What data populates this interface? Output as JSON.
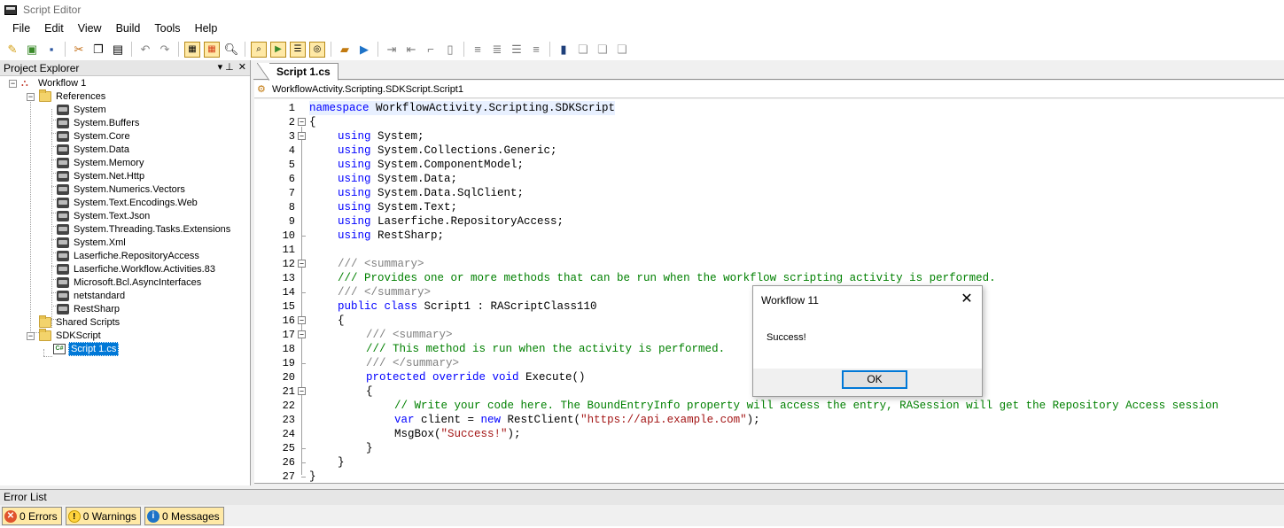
{
  "window": {
    "title": "Script Editor"
  },
  "menu": [
    "File",
    "Edit",
    "View",
    "Build",
    "Tools",
    "Help"
  ],
  "toolbar_icons": [
    "new-icon",
    "open-icon",
    "save-icon",
    "cut-icon",
    "copy-icon",
    "paste-icon",
    "undo-icon",
    "redo-icon",
    "toggle-view-icon",
    "highlight-icon",
    "find-icon",
    "find-replace-icon",
    "run-window-icon",
    "script-window-icon",
    "debug-window-icon",
    "build-icon",
    "run-icon",
    "indent-icon",
    "outdent-icon",
    "comment-icon",
    "uncomment-icon",
    "align-left-icon",
    "align-center-icon",
    "align-right-icon",
    "justify-icon",
    "window-icon",
    "cascade-icon",
    "tile-icon",
    "close-all-icon"
  ],
  "project_explorer": {
    "title": "Project Explorer",
    "pin_label": "▾ ⊥",
    "close_label": "✕",
    "root": "Workflow 1",
    "references_label": "References",
    "references": [
      "System",
      "System.Buffers",
      "System.Core",
      "System.Data",
      "System.Memory",
      "System.Net.Http",
      "System.Numerics.Vectors",
      "System.Text.Encodings.Web",
      "System.Text.Json",
      "System.Threading.Tasks.Extensions",
      "System.Xml",
      "Laserfiche.RepositoryAccess",
      "Laserfiche.Workflow.Activities.83",
      "Microsoft.Bcl.AsyncInterfaces",
      "netstandard",
      "RestSharp"
    ],
    "shared_scripts": "Shared Scripts",
    "sdk_script": "SDKScript",
    "selected_file": "Script 1.cs"
  },
  "editor": {
    "tab": "Script 1.cs",
    "class_path": "WorkflowActivity.Scripting.SDKScript.Script1",
    "line_numbers": [
      "1",
      "2",
      "3",
      "4",
      "5",
      "6",
      "7",
      "8",
      "9",
      "10",
      "11",
      "12",
      "13",
      "14",
      "15",
      "16",
      "17",
      "18",
      "19",
      "20",
      "21",
      "22",
      "23",
      "24",
      "25",
      "26",
      "27"
    ],
    "code": {
      "l1_kw": "namespace",
      "l1_rest": " WorkflowActivity.Scripting.SDKScript",
      "l2": "{",
      "using_kw": "using",
      "l3": " System;",
      "l4": " System.Collections.Generic;",
      "l5": " System.ComponentModel;",
      "l6": " System.Data;",
      "l7": " System.Data.SqlClient;",
      "l8": " System.Text;",
      "l9": " Laserfiche.RepositoryAccess;",
      "l10": " RestSharp;",
      "doc_prefix": "/// ",
      "summary_open": "<summary>",
      "summary_close": "</summary>",
      "l13": "/// Provides one or more methods that can be run when the workflow scripting activity is performed.",
      "l15_kw": "public class",
      "l15_rest": " Script1 : RAScriptClass110",
      "l16": "{",
      "l18": "/// This method is run when the activity is performed.",
      "l20_kw": "protected override void",
      "l20_rest": " Execute()",
      "l21": "{",
      "l22": "// Write your code here. The BoundEntryInfo property will access the entry, RASession will get the Repository Access session",
      "l23_kw1": "var",
      "l23_a": " client = ",
      "l23_kw2": "new",
      "l23_b": " RestClient(",
      "l23_str": "\"https://api.example.com\"",
      "l23_c": ");",
      "l24_a": "MsgBox(",
      "l24_str": "\"Success!\"",
      "l24_b": ");",
      "l25": "}",
      "l26": "}",
      "l27": "}"
    }
  },
  "dialog": {
    "title": "Workflow 11",
    "close_label": "✕",
    "message": "Success!",
    "ok_label": "OK"
  },
  "error_list": {
    "title": "Error List",
    "errors": "0 Errors",
    "warnings": "0 Warnings",
    "messages": "0 Messages"
  }
}
